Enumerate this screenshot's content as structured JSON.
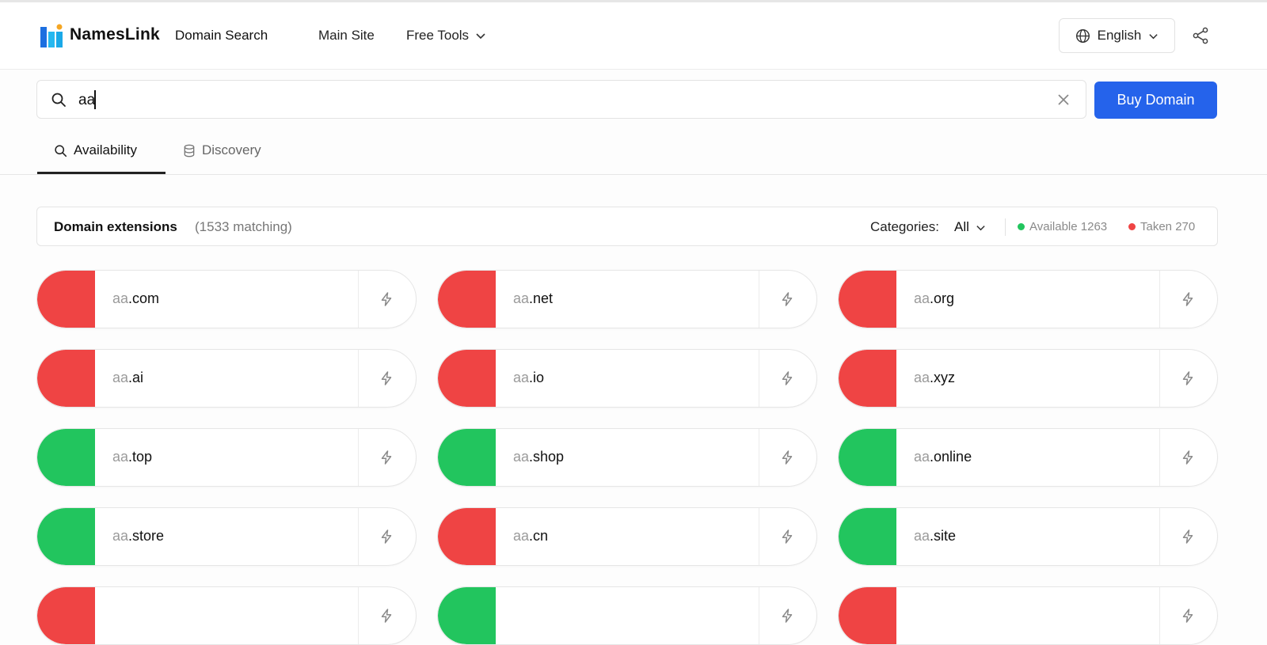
{
  "header": {
    "brand": "NamesLink",
    "subtitle": "Domain Search",
    "nav": {
      "main_site": "Main Site",
      "free_tools": "Free Tools"
    },
    "language": "English"
  },
  "search": {
    "value": "aa",
    "buy_button": "Buy Domain"
  },
  "tabs": [
    {
      "label": "Availability",
      "active": true,
      "icon": "search-icon"
    },
    {
      "label": "Discovery",
      "active": false,
      "icon": "database-icon"
    }
  ],
  "extensions": {
    "title": "Domain extensions",
    "count_text": "(1533 matching)",
    "categories_label": "Categories:",
    "categories_value": "All",
    "available_text": "Available 1263",
    "taken_text": "Taken 270"
  },
  "colors": {
    "available": "#22c55e",
    "taken": "#ef4444",
    "accent": "#2563eb"
  },
  "domains": [
    {
      "keyword": "aa",
      "tld": ".com",
      "status": "taken"
    },
    {
      "keyword": "aa",
      "tld": ".net",
      "status": "taken"
    },
    {
      "keyword": "aa",
      "tld": ".org",
      "status": "taken"
    },
    {
      "keyword": "aa",
      "tld": ".ai",
      "status": "taken"
    },
    {
      "keyword": "aa",
      "tld": ".io",
      "status": "taken"
    },
    {
      "keyword": "aa",
      "tld": ".xyz",
      "status": "taken"
    },
    {
      "keyword": "aa",
      "tld": ".top",
      "status": "available"
    },
    {
      "keyword": "aa",
      "tld": ".shop",
      "status": "available"
    },
    {
      "keyword": "aa",
      "tld": ".online",
      "status": "available"
    },
    {
      "keyword": "aa",
      "tld": ".store",
      "status": "available"
    },
    {
      "keyword": "aa",
      "tld": ".cn",
      "status": "taken"
    },
    {
      "keyword": "aa",
      "tld": ".site",
      "status": "available"
    },
    {
      "keyword": "",
      "tld": "",
      "status": "taken"
    },
    {
      "keyword": "",
      "tld": "",
      "status": "available"
    },
    {
      "keyword": "",
      "tld": "",
      "status": "taken"
    }
  ]
}
